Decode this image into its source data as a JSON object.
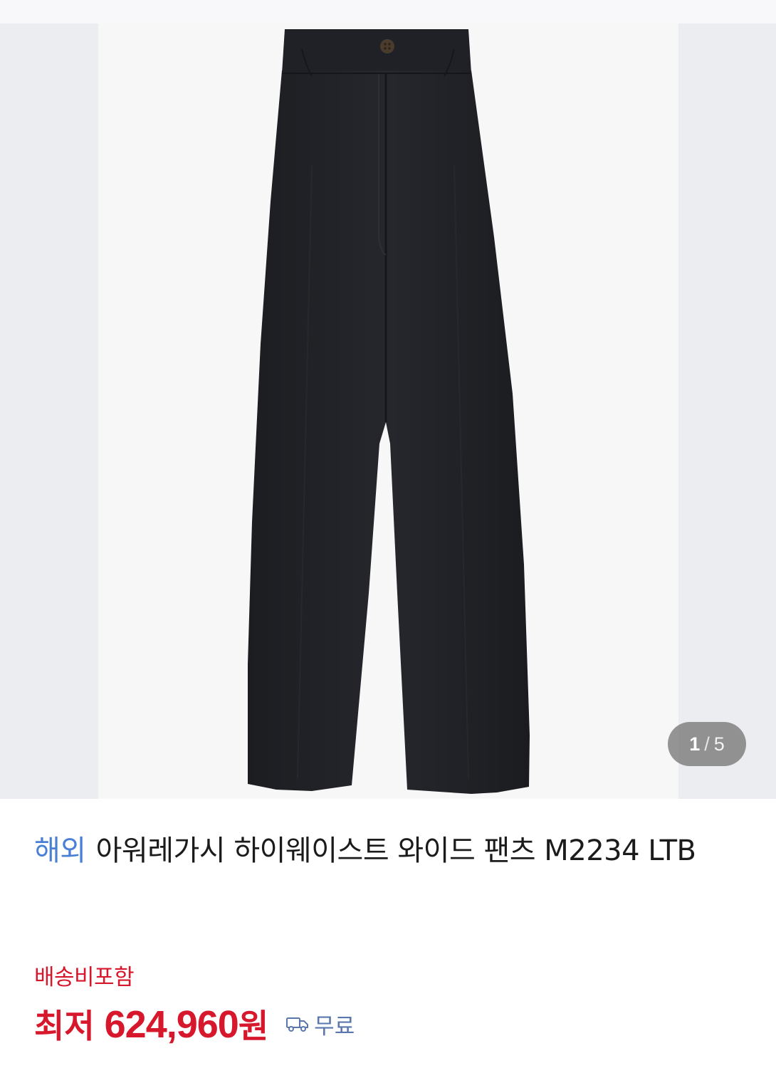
{
  "gallery": {
    "image_alt": "black high-waist wide pants",
    "counter": {
      "current": "1",
      "separator": "/",
      "total": "5"
    }
  },
  "product": {
    "overseas_tag": "해외",
    "title": "아워레가시 하이웨이스트 와이드 팬츠 M2234 LTB",
    "shipping_note": "배송비포함",
    "price_prefix": "최저",
    "price_value": "624,960",
    "price_unit": "원",
    "delivery_label": "무료"
  },
  "colors": {
    "accent_red": "#d6172c",
    "overseas_blue": "#4a7fd6",
    "delivery_blue": "#5a77ad"
  },
  "icons": {
    "delivery": "truck-icon"
  }
}
